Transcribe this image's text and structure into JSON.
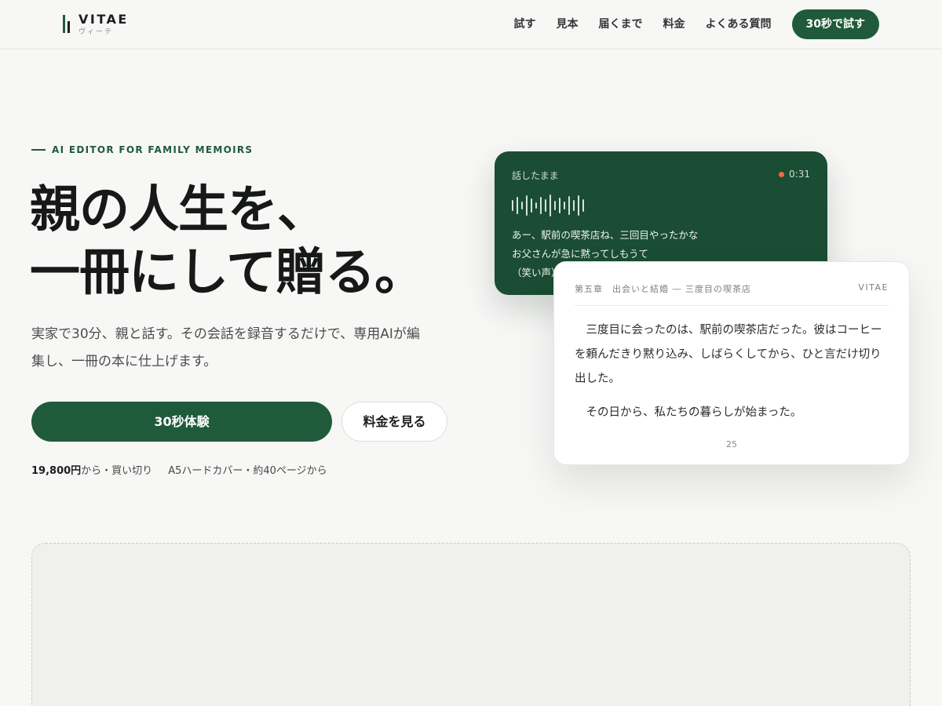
{
  "header": {
    "logo_name": "VITAE",
    "logo_kana": "ヴィーテ",
    "nav": [
      "試す",
      "見本",
      "届くまで",
      "料金",
      "よくある質問"
    ],
    "cta": "30秒で試す"
  },
  "hero": {
    "eyebrow": "AI EDITOR FOR FAMILY MEMOIRS",
    "headline_line1": "親の人生を、",
    "headline_line2": "一冊にして贈る。",
    "lead": "実家で30分、親と話す。その会話を録音するだけで、専用AIが編集し、一冊の本に仕上げます。",
    "primary_button": "30秒体験",
    "secondary_button": "料金を見る",
    "price_bold": "19,800円",
    "price_suffix": "から・買い切り",
    "spec": "A5ハードカバー・約40ページから"
  },
  "recording_card": {
    "label": "話したまま",
    "time": "0:31",
    "transcript": [
      "あー、駅前の喫茶店ね、三回目やったかな",
      "お父さんが急に黙ってしもうて",
      "（笑い声）"
    ]
  },
  "page_card": {
    "chapter": "第五章　出会いと結婚 ― 三度目の喫茶店",
    "brand": "VITAE",
    "paragraph1": "三度目に会ったのは、駅前の喫茶店だった。彼はコーヒーを頼んだきり黙り込み、しばらくしてから、ひと言だけ切り出した。",
    "paragraph2": "その日から、私たちの暮らしが始まった。",
    "page_number": "25"
  },
  "colors": {
    "brand_green": "#1f5a3a",
    "card_green": "#1a4d33",
    "record_dot": "#f06a4a",
    "background": "#f7f7f6"
  }
}
